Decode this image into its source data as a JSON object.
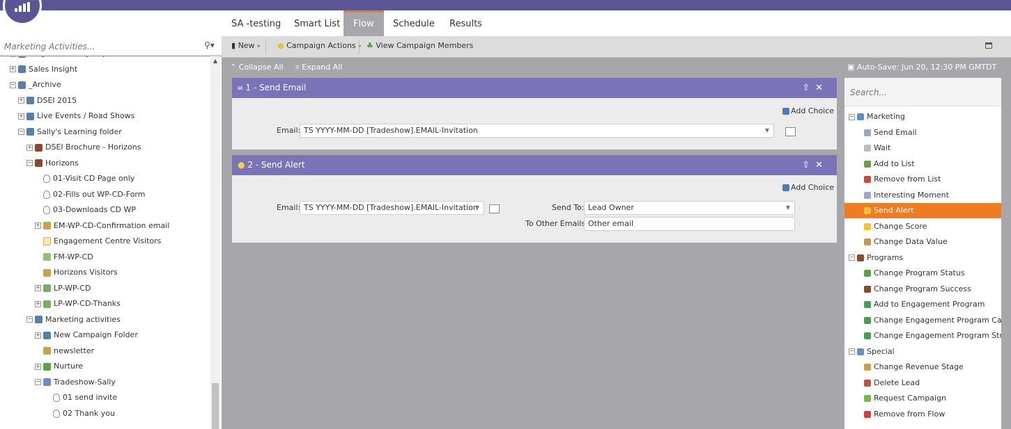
{
  "left_panel": {
    "search_placeholder": "Marketing Activities...",
    "tree": [
      {
        "label": "Program Library Imports",
        "icon": "folder-icon",
        "level": 1
      },
      {
        "label": "Sales Insight",
        "icon": "folder-icon",
        "level": 1
      },
      {
        "label": "_Archive",
        "icon": "folder-icon",
        "level": 1
      },
      {
        "label": "DSEI 2015",
        "icon": "folder-icon",
        "level": 2
      },
      {
        "label": "Live Events / Road Shows",
        "icon": "folder-icon",
        "level": 2
      },
      {
        "label": "Sally's Learning folder",
        "icon": "folder-icon",
        "level": 2
      },
      {
        "label": "DSEI Brochure - Horizons",
        "icon": "program-icon",
        "level": 3
      },
      {
        "label": "Horizons",
        "icon": "program-icon",
        "level": 3
      },
      {
        "label": "01-Visit CD Page only",
        "icon": "smart-campaign-icon",
        "level": 4
      },
      {
        "label": "02-Fills out WP-CD-Form",
        "icon": "smart-campaign-icon",
        "level": 4
      },
      {
        "label": "03-Downloads CD WP",
        "icon": "smart-campaign-icon",
        "level": 4
      },
      {
        "label": "EM-WP-CD-Confirmation email",
        "icon": "email-icon",
        "level": 4
      },
      {
        "label": "Engagement Centre Visitors",
        "icon": "page-icon",
        "level": 4
      },
      {
        "label": "FM-WP-CD",
        "icon": "form-icon",
        "level": 4
      },
      {
        "label": "Horizons Visitors",
        "icon": "list-icon",
        "level": 4
      },
      {
        "label": "LP-WP-CD",
        "icon": "landing-page-icon",
        "level": 4
      },
      {
        "label": "LP-WP-CD-Thanks",
        "icon": "landing-page-icon",
        "level": 4
      },
      {
        "label": "Marketing activities",
        "icon": "folder-icon",
        "level": 3
      },
      {
        "label": "New Campaign Folder",
        "icon": "folder-icon",
        "level": 4
      },
      {
        "label": "newsletter",
        "icon": "email-icon",
        "level": 4
      },
      {
        "label": "Nurture",
        "icon": "nurture-icon",
        "level": 4
      },
      {
        "label": "Tradeshow-Sally",
        "icon": "event-icon",
        "level": 4
      },
      {
        "label": "01 send invite",
        "icon": "smart-campaign-icon",
        "level": 5
      },
      {
        "label": "02 Thank you",
        "icon": "smart-campaign-icon",
        "level": 5
      }
    ]
  },
  "tabs": [
    "SA -testing",
    "Smart List",
    "Flow",
    "Schedule",
    "Results"
  ],
  "active_tab": "Flow",
  "toolbar": {
    "new_label": "New",
    "campaign_actions_label": "Campaign Actions",
    "view_members_label": "View Campaign Members"
  },
  "flow_controls": {
    "collapse_all": "Collapse All",
    "expand_all": "Expand All",
    "autosave": "Auto-Save: Jun 20, 12:30 PM GMTDT"
  },
  "steps": [
    {
      "title": "1 - Send Email",
      "add_choice": "Add Choice",
      "email_label": "Email:",
      "email_value": "TS YYYY-MM-DD [Tradeshow].EMAIL-Invitation"
    },
    {
      "title": "2 - Send Alert",
      "add_choice": "Add Choice",
      "email_label": "Email:",
      "email_value": "TS YYYY-MM-DD [Tradeshow].EMAIL-Invitation",
      "send_to_label": "Send To:",
      "send_to_value": "Lead Owner",
      "other_emails_label": "To Other Emails:",
      "other_emails_value": "Other email"
    }
  ],
  "palette": {
    "search_placeholder": "Search...",
    "items": [
      {
        "label": "Marketing",
        "group": true,
        "color": "#5a8fc4"
      },
      {
        "label": "Send Email",
        "group": false,
        "color": "#9aa8b8"
      },
      {
        "label": "Wait",
        "group": false,
        "color": "#bbbbbb"
      },
      {
        "label": "Add to List",
        "group": false,
        "color": "#6aa04a"
      },
      {
        "label": "Remove from List",
        "group": false,
        "color": "#c84a3a"
      },
      {
        "label": "Interesting Moment",
        "group": false,
        "color": "#9aa8d0"
      },
      {
        "label": "Send Alert",
        "group": false,
        "color": "#e8c040",
        "selected": true
      },
      {
        "label": "Change Score",
        "group": false,
        "color": "#f5c530"
      },
      {
        "label": "Change Data Value",
        "group": false,
        "color": "#b89a5a"
      },
      {
        "label": "Programs",
        "group": true,
        "color": "#8b4a2f"
      },
      {
        "label": "Change Program Status",
        "group": false,
        "color": "#5aa04a"
      },
      {
        "label": "Change Program Success",
        "group": false,
        "color": "#8b4a2f"
      },
      {
        "label": "Add to Engagement Program",
        "group": false,
        "color": "#4a9a5a"
      },
      {
        "label": "Change Engagement Program Cadence",
        "group": false,
        "color": "#4a9a5a"
      },
      {
        "label": "Change Engagement Program Stream",
        "group": false,
        "color": "#4a9a5a"
      },
      {
        "label": "Special",
        "group": true,
        "color": "#6a8ec4"
      },
      {
        "label": "Change Revenue Stage",
        "group": false,
        "color": "#c9a14a"
      },
      {
        "label": "Delete Lead",
        "group": false,
        "color": "#c05050"
      },
      {
        "label": "Request Campaign",
        "group": false,
        "color": "#7ab84a"
      },
      {
        "label": "Remove from Flow",
        "group": false,
        "color": "#d04040"
      }
    ]
  },
  "colors": {
    "brand": "#5b5596",
    "card_header": "#7a73b8",
    "accent": "#f07c22",
    "canvas": "#a7a7ab"
  }
}
